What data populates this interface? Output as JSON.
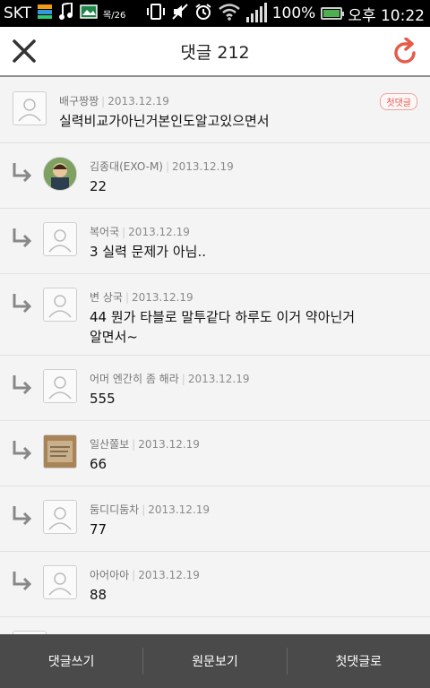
{
  "status_bar": {
    "carrier": "SKT",
    "notif_small": "목/26",
    "battery_level": 1.0,
    "battery_text": "100%",
    "time": "오후 10:22"
  },
  "header": {
    "title": "댓글 212",
    "close_icon": "close-icon",
    "refresh_icon": "refresh-icon",
    "accent_color": "#e55b4b"
  },
  "comments": [
    {
      "author": "배구짱짱",
      "date": "2013.12.19",
      "text": "실력비교가아닌거본인도알고있으면서",
      "badge": "첫댓글",
      "type": "top",
      "avatar": "default"
    },
    {
      "author": "김종대(EXO-M)",
      "date": "2013.12.19",
      "text": "22",
      "type": "reply",
      "avatar": "photo"
    },
    {
      "author": "복어국",
      "date": "2013.12.19",
      "text": "3 실력 문제가 아님..",
      "type": "reply",
      "avatar": "default"
    },
    {
      "author": "변 상국",
      "date": "2013.12.19",
      "text": "44 뭔가 타블로 말투같다 하루도 이거 약아닌거\n알면서~",
      "type": "tall",
      "avatar": "default"
    },
    {
      "author": "어머 엔간히 좀 해라",
      "date": "2013.12.19",
      "text": "555",
      "type": "reply",
      "avatar": "default"
    },
    {
      "author": "일산쫄보",
      "date": "2013.12.19",
      "text": "66",
      "type": "reply",
      "avatar": "paper"
    },
    {
      "author": "둠디디둠차",
      "date": "2013.12.19",
      "text": "77",
      "type": "reply",
      "avatar": "default"
    },
    {
      "author": "아어아아",
      "date": "2013.12.19",
      "text": "88",
      "type": "reply",
      "avatar": "default"
    }
  ],
  "bottom_bar": {
    "write": "댓글쓰기",
    "original": "원문보기",
    "first": "첫댓글로"
  }
}
